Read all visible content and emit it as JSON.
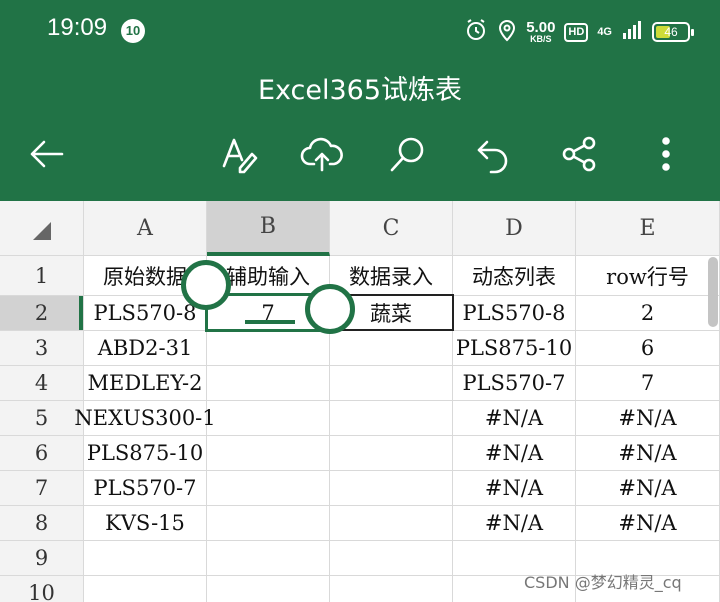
{
  "status_bar": {
    "time": "19:09",
    "notification_count": "10",
    "speed_value": "5.00",
    "speed_unit": "KB/S",
    "hd_label": "HD",
    "network_label": "4G",
    "battery_level": "46",
    "battery_fraction": 0.46
  },
  "app_bar": {
    "title": "Excel365试炼表",
    "buttons": [
      "back-arrow-icon",
      "format-text-icon",
      "cloud-upload-icon",
      "search-icon",
      "undo-icon",
      "share-icon",
      "more-icon"
    ]
  },
  "sheet": {
    "columns": [
      "A",
      "B",
      "C",
      "D",
      "E"
    ],
    "selected_column": "B",
    "rows": [
      "1",
      "2",
      "3",
      "4",
      "5",
      "6",
      "7",
      "8",
      "9",
      "10"
    ],
    "selected_row": "2",
    "cells": {
      "A": [
        "原始数据",
        "PLS570-8",
        "ABD2-31",
        "MEDLEY-2",
        "NEXUS300-1",
        "PLS875-10",
        "PLS570-7",
        "KVS-15",
        "",
        ""
      ],
      "B": [
        "辅助输入",
        "7",
        "",
        "",
        "",
        "",
        "",
        "",
        "",
        ""
      ],
      "C": [
        "数据录入",
        "蔬菜",
        "",
        "",
        "",
        "",
        "",
        "",
        "",
        ""
      ],
      "D": [
        "动态列表",
        "PLS570-8",
        "PLS875-10",
        "PLS570-7",
        "#N/A",
        "#N/A",
        "#N/A",
        "#N/A",
        "",
        ""
      ],
      "E": [
        "row行号",
        "2",
        "6",
        "7",
        "#N/A",
        "#N/A",
        "#N/A",
        "#N/A",
        "",
        ""
      ]
    }
  },
  "watermark": "CSDN @梦幻精灵_cq",
  "colors": {
    "excel_green": "#217346",
    "header_gray": "#f3f3f3",
    "selected_header": "#d2d2d2",
    "gridline": "#d9d9d9"
  }
}
